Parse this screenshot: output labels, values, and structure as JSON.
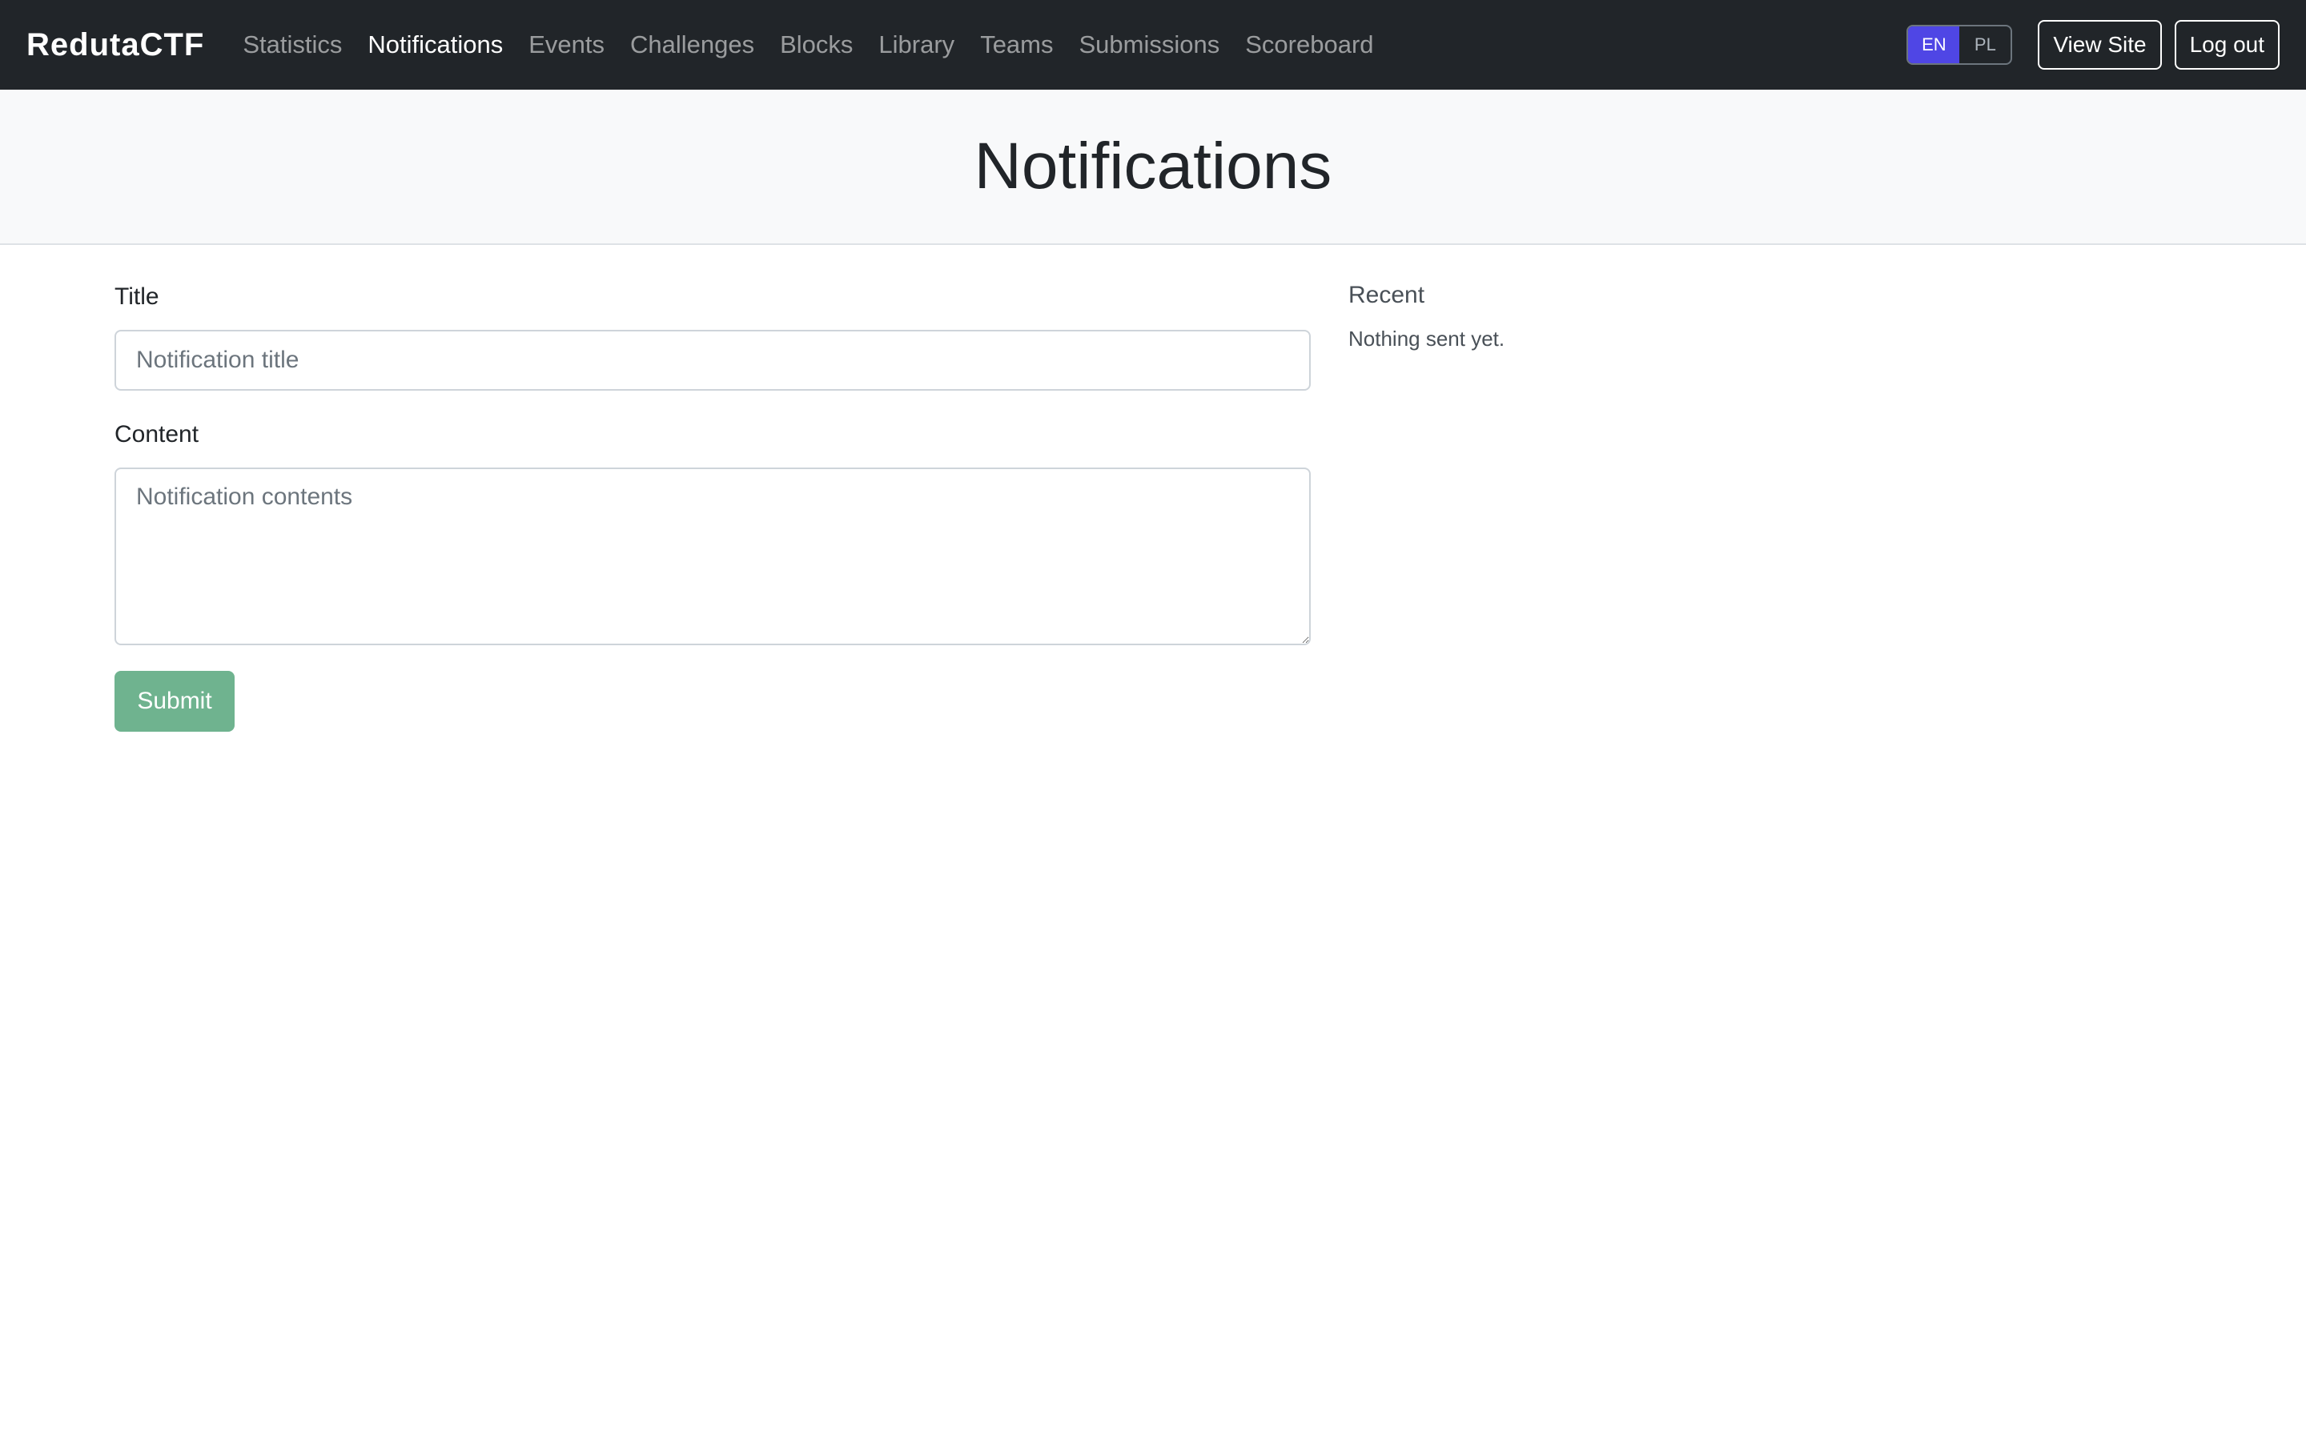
{
  "navbar": {
    "brand": "RedutaCTF",
    "items": [
      {
        "label": "Statistics",
        "active": false
      },
      {
        "label": "Notifications",
        "active": true
      },
      {
        "label": "Events",
        "active": false
      },
      {
        "label": "Challenges",
        "active": false
      },
      {
        "label": "Blocks",
        "active": false
      },
      {
        "label": "Library",
        "active": false
      },
      {
        "label": "Teams",
        "active": false
      },
      {
        "label": "Submissions",
        "active": false
      },
      {
        "label": "Scoreboard",
        "active": false
      }
    ],
    "lang": {
      "en": "EN",
      "pl": "PL",
      "selected": "EN"
    },
    "view_site": "View Site",
    "logout": "Log out"
  },
  "header": {
    "title": "Notifications"
  },
  "form": {
    "title_label": "Title",
    "title_placeholder": "Notification title",
    "title_value": "",
    "content_label": "Content",
    "content_placeholder": "Notification contents",
    "content_value": "",
    "submit": "Submit"
  },
  "recent": {
    "heading": "Recent",
    "empty": "Nothing sent yet."
  },
  "colors": {
    "navbar_bg": "#212529",
    "lang_active": "#4f46e5",
    "submit_bg": "#6fb38f",
    "header_bg": "#f8f9fa"
  }
}
